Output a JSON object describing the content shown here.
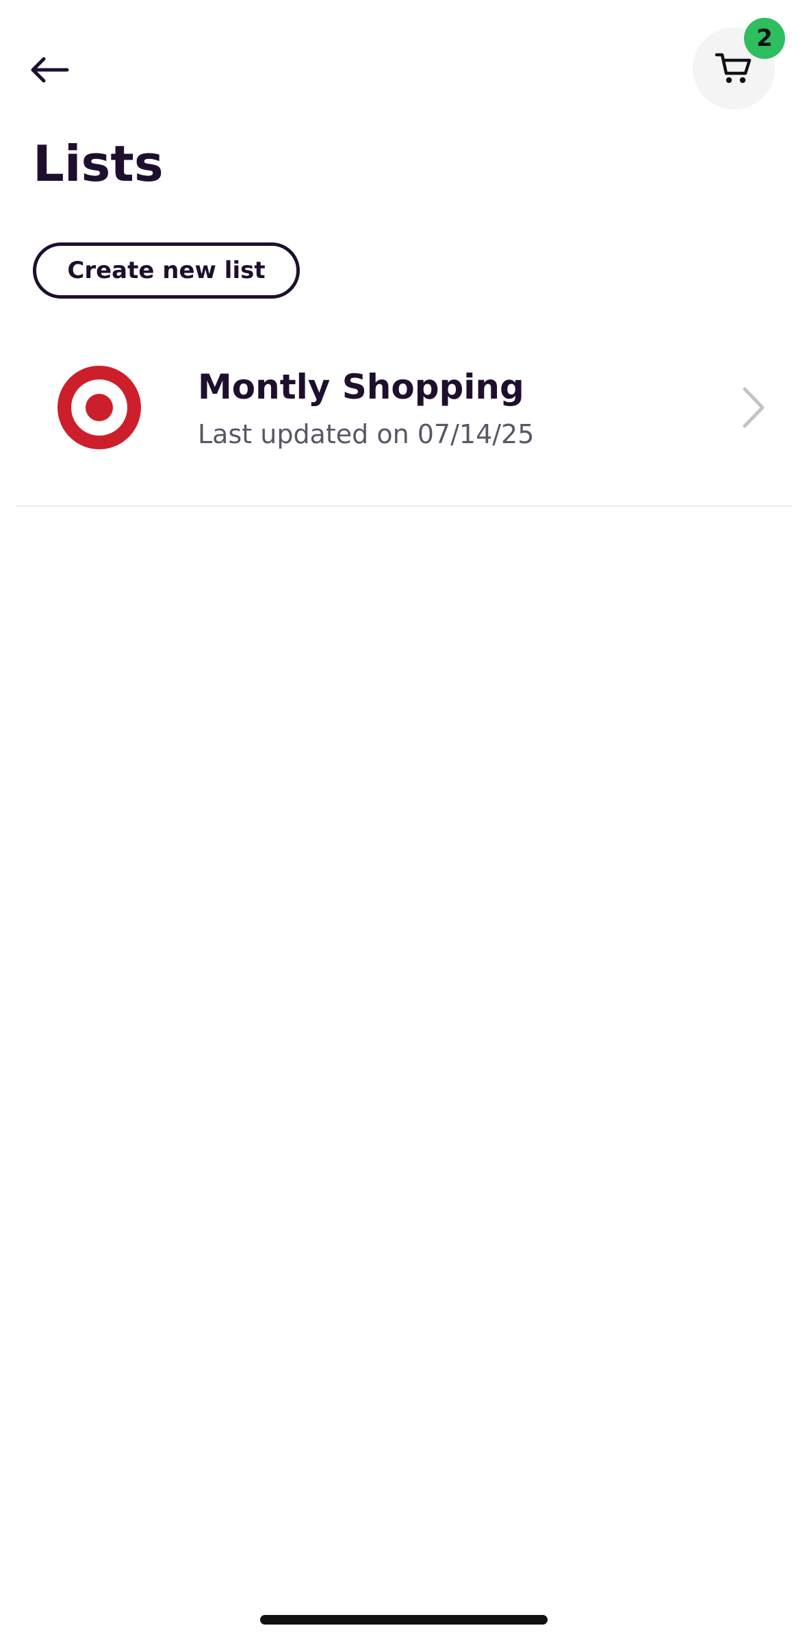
{
  "header": {
    "back_icon": "arrow-left-icon",
    "cart_icon": "cart-icon",
    "cart_count": "2",
    "badge_color": "#2ebd5f"
  },
  "page": {
    "title": "Lists"
  },
  "actions": {
    "create_list_label": "Create new list"
  },
  "lists": [
    {
      "logo": "target-logo",
      "logo_color": "#cc1f2b",
      "title": "Montly Shopping",
      "subtitle": "Last updated on 07/14/25"
    }
  ]
}
